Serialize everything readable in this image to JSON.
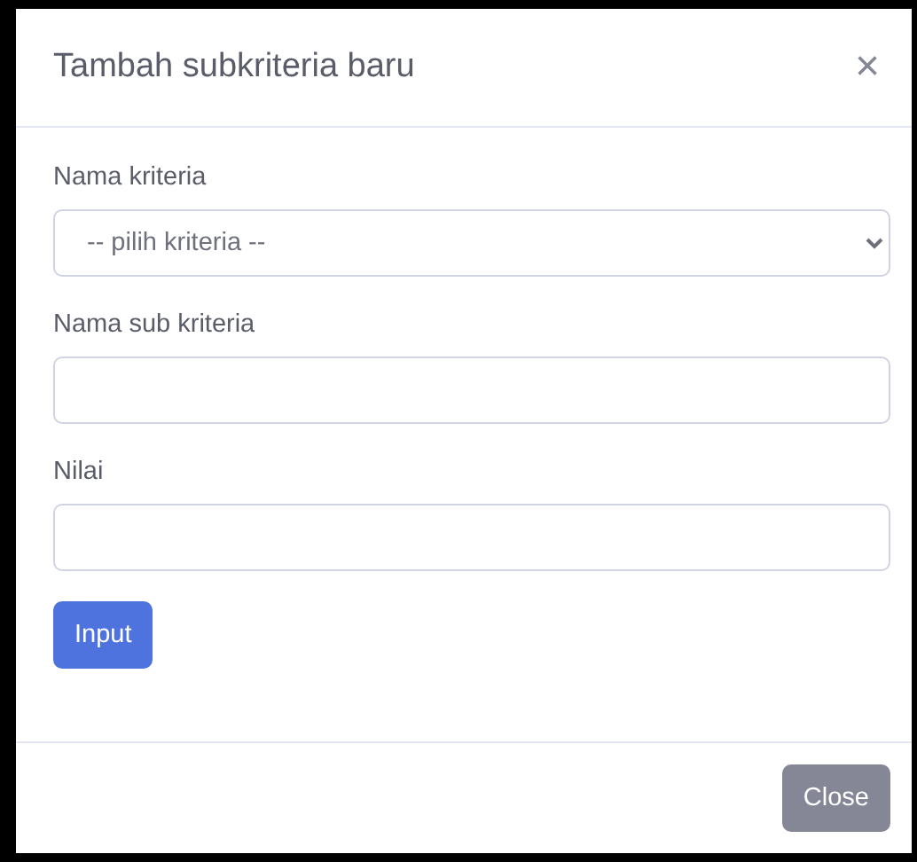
{
  "modal": {
    "title": "Tambah subkriteria baru",
    "close_icon": "×"
  },
  "form": {
    "fields": [
      {
        "kind": "select",
        "label": "Nama kriteria",
        "value": "-- pilih kriteria --"
      },
      {
        "kind": "input",
        "label": "Nama sub kriteria"
      },
      {
        "kind": "input",
        "label": "Nilai"
      }
    ],
    "submit": "Input"
  },
  "footer": {
    "close": "Close"
  }
}
